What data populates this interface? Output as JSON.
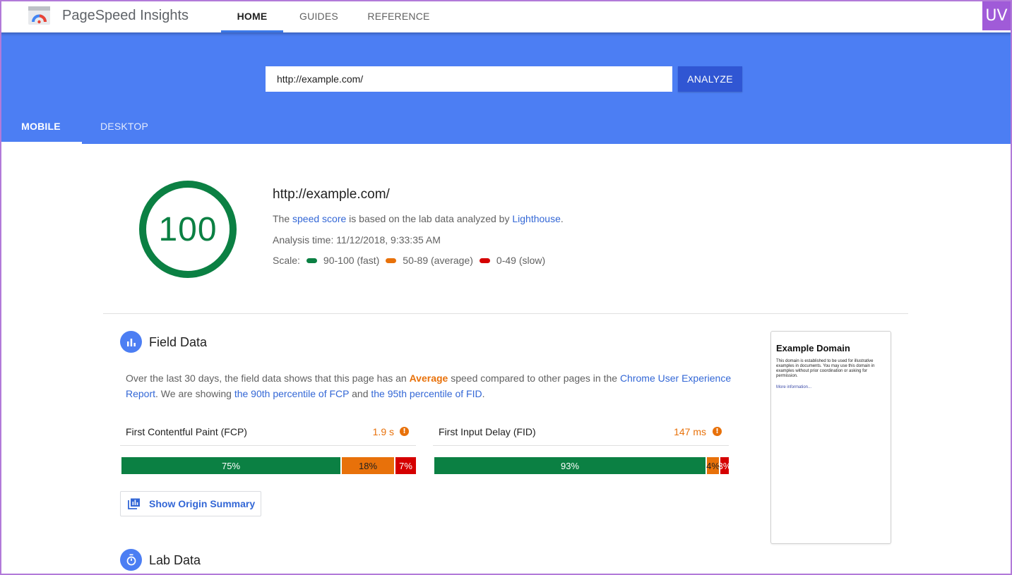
{
  "app": {
    "title": "PageSpeed Insights",
    "nav": [
      {
        "label": "HOME",
        "active": true
      },
      {
        "label": "GUIDES",
        "active": false
      },
      {
        "label": "REFERENCE",
        "active": false
      }
    ],
    "badge": "UV"
  },
  "search": {
    "url_value": "http://example.com/",
    "analyze_label": "ANALYZE"
  },
  "device_tabs": [
    {
      "label": "MOBILE",
      "active": true
    },
    {
      "label": "DESKTOP",
      "active": false
    }
  ],
  "score": {
    "value": "100",
    "url": "http://example.com/",
    "line1_prefix": "The ",
    "line1_link": "speed score",
    "line1_mid": " is based on the lab data analyzed by ",
    "line1_link2": "Lighthouse",
    "line1_suffix": ".",
    "analysis_time": "Analysis time: 11/12/2018, 9:33:35 AM",
    "scale_label": "Scale:",
    "scale": [
      {
        "label": "90-100 (fast)",
        "color": "#0b8043"
      },
      {
        "label": "50-89 (average)",
        "color": "#e8710a"
      },
      {
        "label": "0-49 (slow)",
        "color": "#d50000"
      }
    ]
  },
  "field_data": {
    "title": "Field Data",
    "p_1": "Over the last 30 days, the field data shows that this page has an ",
    "p_avg": "Average",
    "p_2": " speed compared to other pages in the ",
    "p_link1": "Chrome User Experience Report",
    "p_3": ". We are showing ",
    "p_link2": "the 90th percentile of FCP",
    "p_4": " and ",
    "p_link3": "the 95th percentile of FID",
    "p_5": ".",
    "metrics": [
      {
        "label": "First Contentful Paint (FCP)",
        "value": "1.9 s",
        "dist": [
          {
            "pct": 75,
            "text": "75%"
          },
          {
            "pct": 18,
            "text": "18%"
          },
          {
            "pct": 7,
            "text": "7%"
          }
        ]
      },
      {
        "label": "First Input Delay (FID)",
        "value": "147 ms",
        "dist": [
          {
            "pct": 93,
            "text": "93%"
          },
          {
            "pct": 4,
            "text": "4%"
          },
          {
            "pct": 3,
            "text": "3%"
          }
        ]
      }
    ],
    "origin_button": "Show Origin Summary"
  },
  "lab_data": {
    "title": "Lab Data"
  },
  "preview": {
    "title": "Example Domain",
    "body": "This domain is established to be used for illustrative examples in documents. You may use this domain in examples without prior coordination or asking for permission.",
    "link": "More information..."
  },
  "colors": {
    "brand_blue": "#4c7ef3",
    "fast": "#0b8043",
    "average": "#e8710a",
    "slow": "#d50000"
  }
}
